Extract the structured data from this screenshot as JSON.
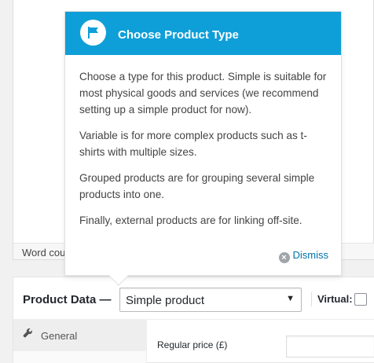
{
  "status_bar": {
    "word_count_label": "Word count"
  },
  "product_data": {
    "title": "Product Data —",
    "type_select": {
      "selected": "Simple product"
    },
    "virtual_label": "Virtual:",
    "tabs": [
      {
        "label": "General"
      }
    ],
    "fields": {
      "regular_price_label": "Regular price (£)"
    }
  },
  "pointer": {
    "title": "Choose Product Type",
    "paragraphs": [
      "Choose a type for this product. Simple is suitable for most physical goods and services (we recommend setting up a simple product for now).",
      "Variable is for more complex products such as t-shirts with multiple sizes.",
      "Grouped products are for grouping several simple products into one.",
      "Finally, external products are for linking off-site."
    ],
    "dismiss_label": "Dismiss"
  },
  "colors": {
    "pointer_header": "#0f9fd8",
    "link": "#0073aa"
  },
  "icons": {
    "pointer": "flag-icon",
    "general_tab": "wrench-icon",
    "dismiss": "close-circle-icon"
  }
}
